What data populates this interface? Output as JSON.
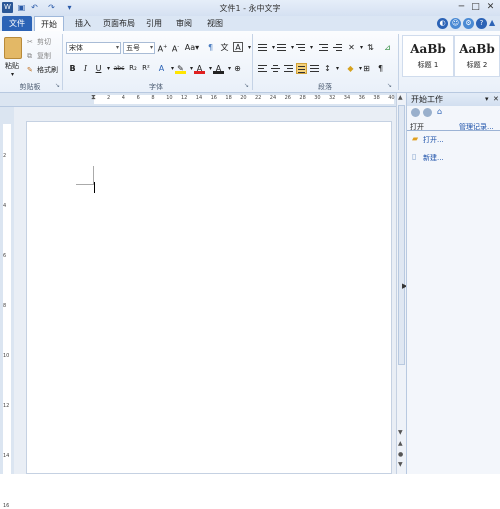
{
  "window": {
    "title": "文件1 - 永中文字"
  },
  "quick_access": [
    "save-icon",
    "undo-icon",
    "redo-icon",
    "customize-icon"
  ],
  "tabs": [
    "文件",
    "开始",
    "插入",
    "页面布局",
    "引用",
    "审阅",
    "视图"
  ],
  "clipboard": {
    "paste": "粘贴",
    "cut": "剪切",
    "copy": "复制",
    "format_painter": "格式刷",
    "group": "剪贴板"
  },
  "font": {
    "name": "宋体",
    "size": "五号",
    "group": "字体",
    "bold": "B",
    "italic": "I",
    "underline": "U",
    "strike": "abc",
    "sub": "R₂",
    "sup": "R²"
  },
  "paragraph": {
    "group": "段落",
    "pilcrow": "¶"
  },
  "styles": [
    {
      "sample": "AaBb",
      "name": "标题 1"
    },
    {
      "sample": "AaBb",
      "name": "标题 2"
    }
  ],
  "ruler": {
    "h_numbers": [
      "2",
      "4",
      "6",
      "8",
      "10",
      "12",
      "14",
      "16",
      "18",
      "20",
      "22",
      "24",
      "26",
      "28",
      "30",
      "32",
      "34",
      "36",
      "38",
      "40"
    ],
    "v_numbers": [
      "2",
      "4",
      "6",
      "8",
      "10",
      "12",
      "14",
      "16"
    ]
  },
  "task_panel": {
    "title": "开始工作",
    "section": "打开",
    "manage": "管理记录...",
    "open_link": "打开...",
    "new_link": "新建..."
  }
}
